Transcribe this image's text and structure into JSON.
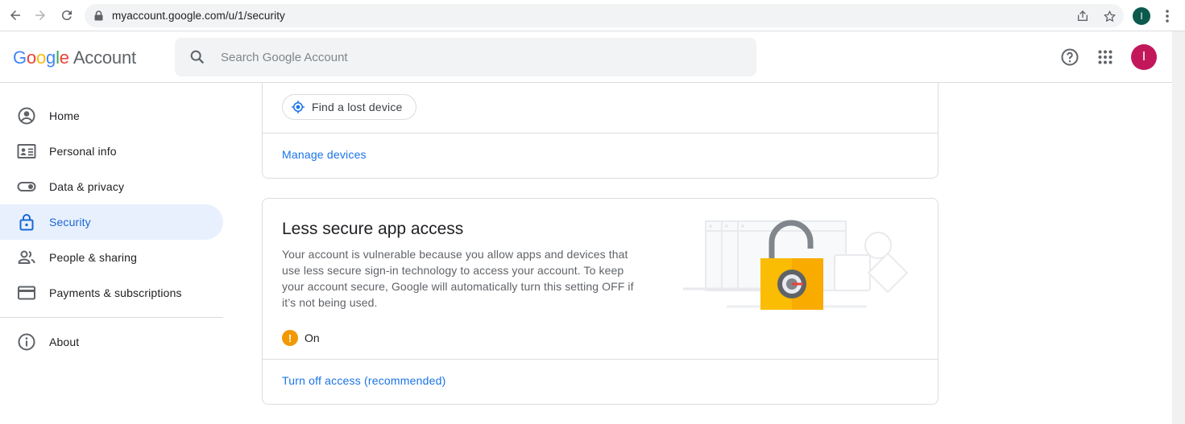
{
  "browser": {
    "url": "myaccount.google.com/u/1/security",
    "profile_initial": "I"
  },
  "header": {
    "logo_parts": [
      "G",
      "o",
      "o",
      "g",
      "l",
      "e"
    ],
    "logo_suffix": "Account",
    "search_placeholder": "Search Google Account",
    "avatar_initial": "I",
    "avatar_color": "#c2185b"
  },
  "sidebar": {
    "items": [
      {
        "label": "Home",
        "icon": "account-circle-icon"
      },
      {
        "label": "Personal info",
        "icon": "id-card-icon"
      },
      {
        "label": "Data & privacy",
        "icon": "toggle-icon"
      },
      {
        "label": "Security",
        "icon": "lock-icon",
        "active": true
      },
      {
        "label": "People & sharing",
        "icon": "people-icon"
      },
      {
        "label": "Payments & subscriptions",
        "icon": "credit-card-icon"
      }
    ],
    "about": {
      "label": "About",
      "icon": "info-icon"
    }
  },
  "devices_card": {
    "find_device_label": "Find a lost device",
    "manage_link": "Manage devices"
  },
  "less_secure_card": {
    "title": "Less secure app access",
    "description": "Your account is vulnerable because you allow apps and devices that use less secure sign-in technology to access your account. To keep your account secure, Google will automatically turn this setting OFF if it’s not being used.",
    "status_icon": "!",
    "status": "On",
    "action_link": "Turn off access (recommended)"
  },
  "colors": {
    "accent": "#1a73e8",
    "active_bg": "#e8f0fe",
    "warning": "#f29900"
  }
}
